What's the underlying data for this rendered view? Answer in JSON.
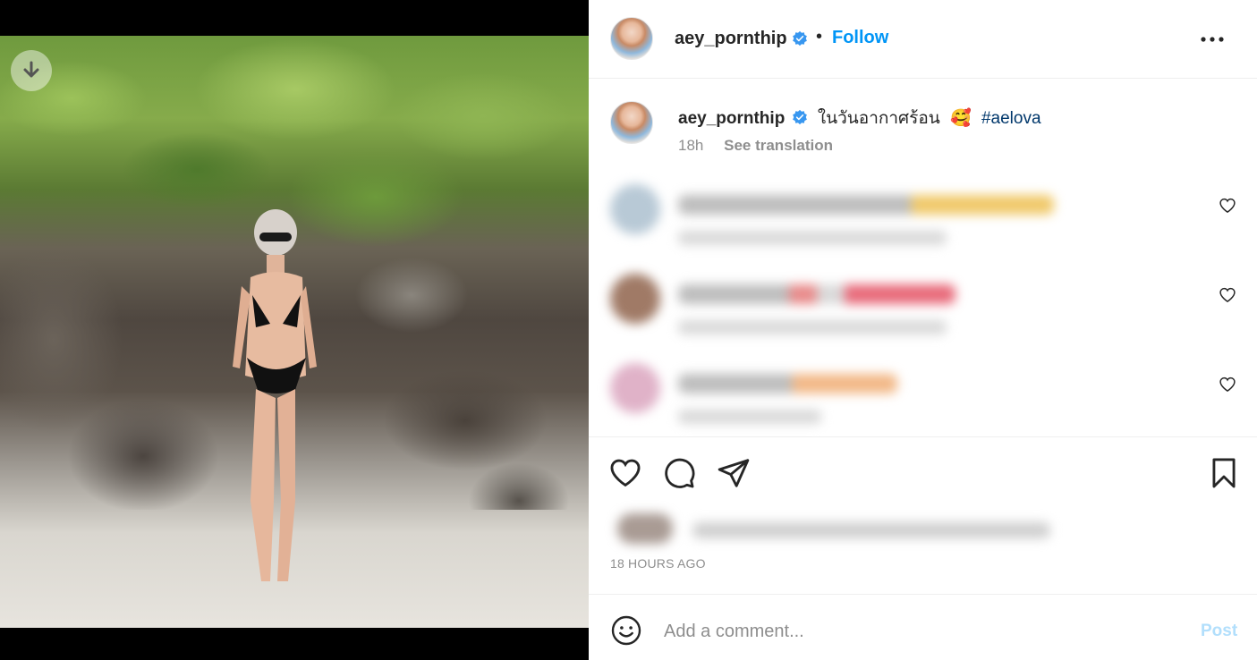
{
  "post": {
    "username": "aey_pornthip",
    "follow_label": "Follow",
    "dot": "•"
  },
  "caption": {
    "username": "aey_pornthip",
    "text": "ในวันอากาศร้อน",
    "emoji": "🥰",
    "hashtag": "#aelova",
    "age": "18h",
    "see_translation": "See translation"
  },
  "timestamp": "18 HOURS AGO",
  "add_comment": {
    "placeholder": "Add a comment...",
    "post_label": "Post"
  },
  "icons": {
    "save_photo": "download-icon",
    "more": "more-options-icon",
    "verified": "verified-badge-icon",
    "like": "heart-icon",
    "comment": "comment-icon",
    "share": "share-icon",
    "save": "bookmark-icon",
    "emoji": "emoji-icon"
  },
  "colors": {
    "accent": "#0095f6",
    "hashtag": "#00376b",
    "muted": "#8e8e8e",
    "post_disabled": "#b2dffc"
  }
}
